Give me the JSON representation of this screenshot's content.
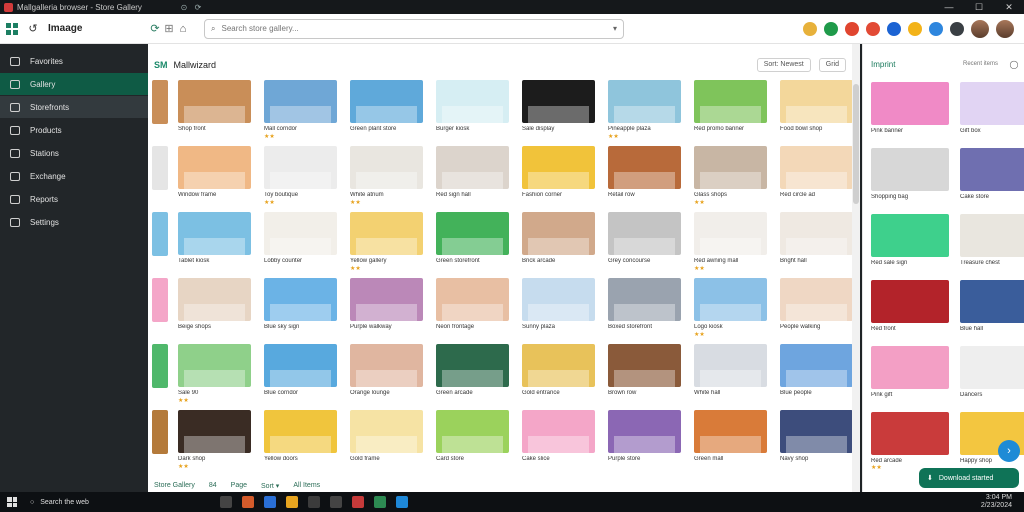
{
  "window": {
    "title": "Mallgalleria browser - Store Gallery",
    "controls": [
      "—",
      "☐",
      "✕"
    ]
  },
  "toolbar": {
    "brand": "Imaage",
    "search_placeholder": "Search store gallery..."
  },
  "sidebar": {
    "items": [
      {
        "label": "Favorites"
      },
      {
        "label": "Gallery"
      },
      {
        "label": "Storefronts"
      },
      {
        "label": "Products"
      },
      {
        "label": "Stations"
      },
      {
        "label": "Exchange"
      },
      {
        "label": "Reports"
      },
      {
        "label": "Settings"
      }
    ]
  },
  "main": {
    "badge": "SM",
    "title": "Mallwizard",
    "pill_left": "Sort: Newest",
    "pill_right": "Grid",
    "footer": [
      "Store Gallery",
      "84",
      "Page",
      "Sort ▾",
      "All Items"
    ],
    "cards": [
      {
        "caption": "Shop front",
        "rating": "",
        "color": "#c98e58"
      },
      {
        "caption": "Mall corridor",
        "rating": "★★",
        "color": "#6fa7d6"
      },
      {
        "caption": "Green plant store",
        "rating": "",
        "color": "#5fa9da"
      },
      {
        "caption": "Burger kiosk",
        "rating": "",
        "color": "#d6eef3"
      },
      {
        "caption": "Sale display",
        "rating": "",
        "color": "#1c1c1c"
      },
      {
        "caption": "Pineapple plaza",
        "rating": "★★",
        "color": "#8fc5dc"
      },
      {
        "caption": "Red promo banner",
        "rating": "",
        "color": "#7fc45b"
      },
      {
        "caption": "Food bowl shop",
        "rating": "",
        "color": "#f3d79b"
      },
      {
        "caption": "Window frame",
        "rating": "",
        "color": "#f0b885"
      },
      {
        "caption": "Toy boutique",
        "rating": "★★",
        "color": "#ececec"
      },
      {
        "caption": "White atrium",
        "rating": "★★",
        "color": "#e9e6e0"
      },
      {
        "caption": "Red sign hall",
        "rating": "",
        "color": "#dcd4cc"
      },
      {
        "caption": "Fashion corner",
        "rating": "",
        "color": "#f1c33a"
      },
      {
        "caption": "Retail row",
        "rating": "",
        "color": "#b86a3a"
      },
      {
        "caption": "Glass shops",
        "rating": "★★",
        "color": "#c8b6a4"
      },
      {
        "caption": "Red circle ad",
        "rating": "",
        "color": "#f3d8b8"
      },
      {
        "caption": "Tablet kiosk",
        "rating": "",
        "color": "#7cc0e3"
      },
      {
        "caption": "Lobby counter",
        "rating": "",
        "color": "#f2efe9"
      },
      {
        "caption": "Yellow gallery",
        "rating": "★★",
        "color": "#f3d171"
      },
      {
        "caption": "Green storefront",
        "rating": "",
        "color": "#43b25a"
      },
      {
        "caption": "Brick arcade",
        "rating": "",
        "color": "#d1a98b"
      },
      {
        "caption": "Grey concourse",
        "rating": "",
        "color": "#c4c4c4"
      },
      {
        "caption": "Red awning mall",
        "rating": "★★",
        "color": "#f1eeea"
      },
      {
        "caption": "Bright hall",
        "rating": "",
        "color": "#efe9e2"
      },
      {
        "caption": "Beige shops",
        "rating": "",
        "color": "#e7d5c4"
      },
      {
        "caption": "Blue sky sign",
        "rating": "",
        "color": "#6bb3e6"
      },
      {
        "caption": "Purple walkway",
        "rating": "",
        "color": "#bb88b8"
      },
      {
        "caption": "Neon frontage",
        "rating": "",
        "color": "#e8bfa3"
      },
      {
        "caption": "Sunny plaza",
        "rating": "",
        "color": "#c6dcee"
      },
      {
        "caption": "Boxed storefront",
        "rating": "",
        "color": "#9aa3af"
      },
      {
        "caption": "Logo kiosk",
        "rating": "★★",
        "color": "#8cc1e7"
      },
      {
        "caption": "People walking",
        "rating": "",
        "color": "#efd7c4"
      },
      {
        "caption": "Sale 90",
        "rating": "★★",
        "color": "#8fd08a"
      },
      {
        "caption": "Blue corridor",
        "rating": "",
        "color": "#58a9de"
      },
      {
        "caption": "Orange lounge",
        "rating": "",
        "color": "#e0b6a0"
      },
      {
        "caption": "Green arcade",
        "rating": "",
        "color": "#2d6a4c"
      },
      {
        "caption": "Gold entrance",
        "rating": "",
        "color": "#e8c25a"
      },
      {
        "caption": "Brown row",
        "rating": "",
        "color": "#8a5a3a"
      },
      {
        "caption": "White hall",
        "rating": "",
        "color": "#d8dce2"
      },
      {
        "caption": "Blue people",
        "rating": "",
        "color": "#6ea5df"
      },
      {
        "caption": "Dark shop",
        "rating": "★★",
        "color": "#3a2c24"
      },
      {
        "caption": "Yellow doors",
        "rating": "",
        "color": "#f0c53d"
      },
      {
        "caption": "Gold frame",
        "rating": "",
        "color": "#f6e3a4"
      },
      {
        "caption": "Card store",
        "rating": "",
        "color": "#9bd25c"
      },
      {
        "caption": "Cake slice",
        "rating": "",
        "color": "#f4a6c8"
      },
      {
        "caption": "Purple store",
        "rating": "",
        "color": "#8b67b4"
      },
      {
        "caption": "Green mall",
        "rating": "",
        "color": "#d97b39"
      },
      {
        "caption": "Navy shop",
        "rating": "",
        "color": "#3d4d7c"
      }
    ]
  },
  "right_panel": {
    "title": "Imprint",
    "sub": "Recent items",
    "cards": [
      {
        "caption": "Pink banner",
        "rating": "",
        "color": "#f08ac6"
      },
      {
        "caption": "Gift box",
        "rating": "",
        "color": "#e1d4f3"
      },
      {
        "caption": "Shopping bag",
        "rating": "",
        "color": "#d7d7d7"
      },
      {
        "caption": "Cake store",
        "rating": "",
        "color": "#6f6fb0"
      },
      {
        "caption": "Red sale sign",
        "rating": "",
        "color": "#3ed08c"
      },
      {
        "caption": "Treasure chest",
        "rating": "",
        "color": "#e9e6df"
      },
      {
        "caption": "Red front",
        "rating": "",
        "color": "#b3232a"
      },
      {
        "caption": "Blue hall",
        "rating": "",
        "color": "#3a5d9b"
      },
      {
        "caption": "Pink gift",
        "rating": "",
        "color": "#f39fc5"
      },
      {
        "caption": "Dancers",
        "rating": "",
        "color": "#eeeeee"
      },
      {
        "caption": "Red arcade",
        "rating": "★★",
        "color": "#c93b3b"
      },
      {
        "caption": "Happy shop",
        "rating": "",
        "color": "#f3c640"
      }
    ],
    "toast": "Download started",
    "fab": "›"
  },
  "taskbar": {
    "search": "Search the web",
    "time": "3:04 PM",
    "date": "2/23/2024"
  }
}
